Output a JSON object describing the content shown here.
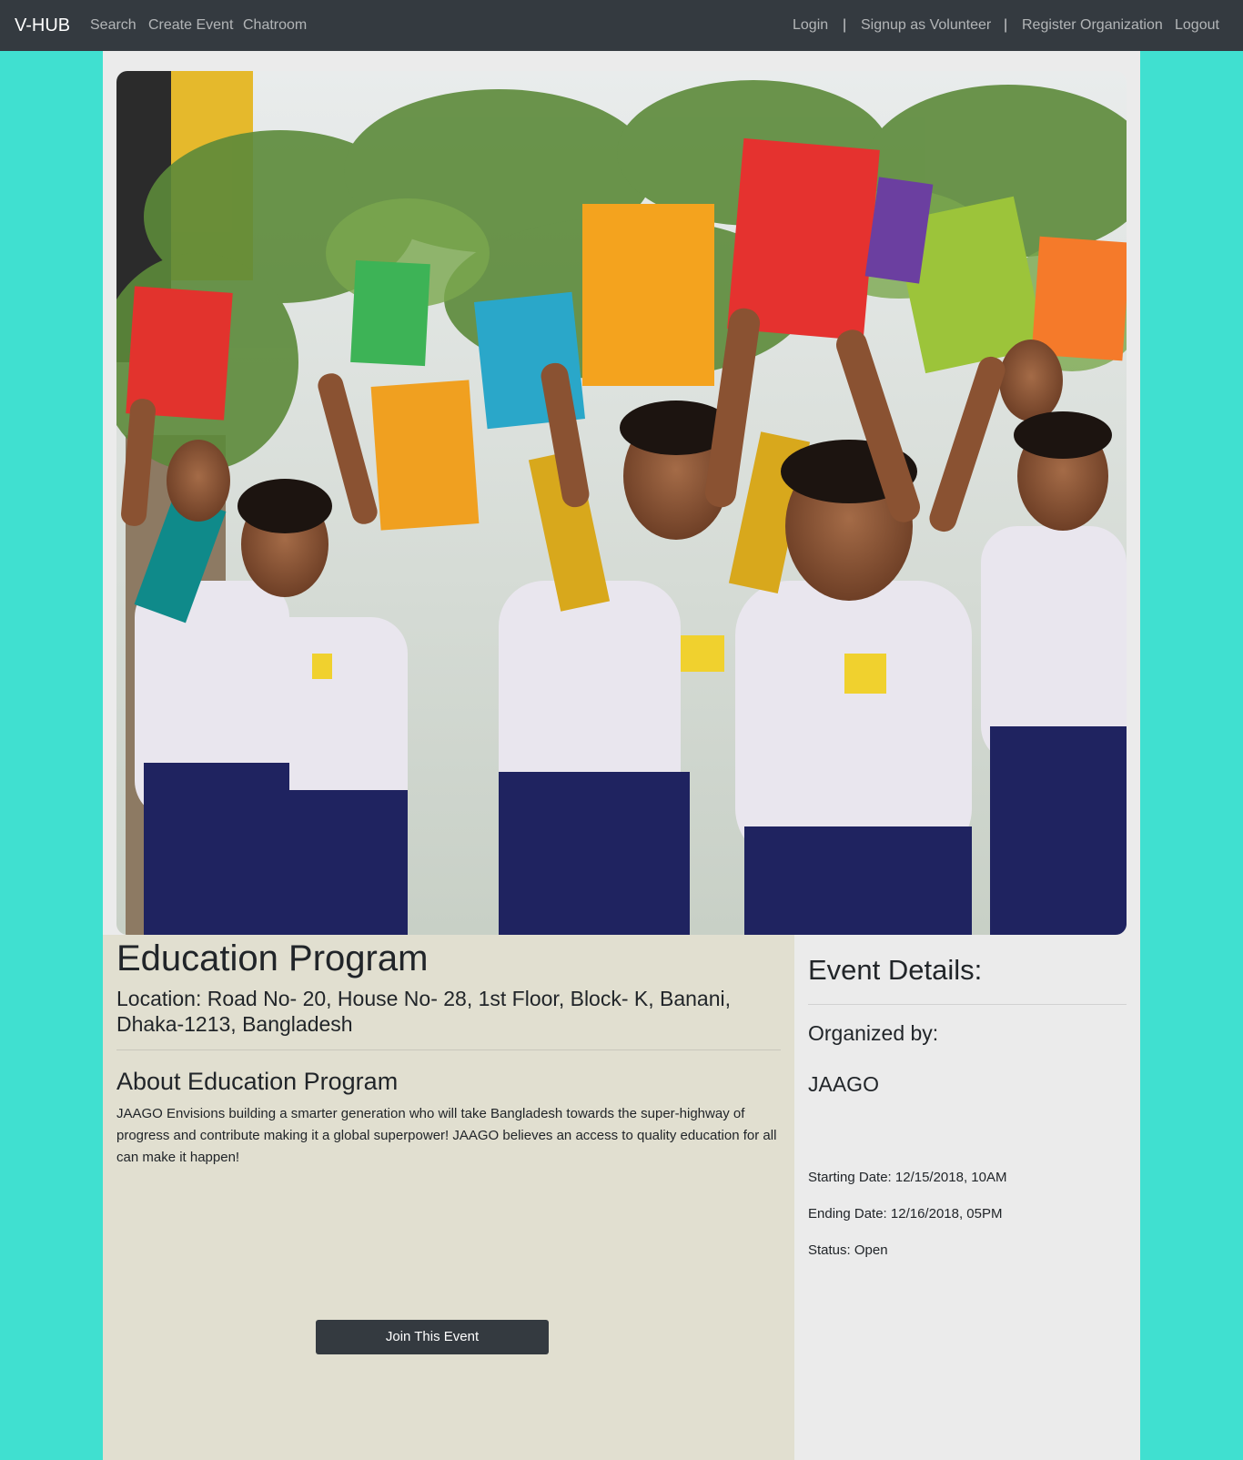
{
  "navbar": {
    "brand": "V-HUB",
    "left_links": [
      "Search",
      "Create Event",
      "Chatroom"
    ],
    "right_links": [
      "Login",
      "Signup as Volunteer",
      "Register Organization",
      "Logout"
    ],
    "separator": "|"
  },
  "hero": {
    "subject": "children in school uniforms holding up textbooks"
  },
  "event": {
    "title": "Education Program",
    "location": "Location: Road No- 20, House No- 28, 1st Floor, Block- K, Banani, Dhaka-1213, Bangladesh",
    "about_heading": "About Education Program",
    "about_text": "JAAGO Envisions building a smarter generation who will take Bangladesh towards the super-highway of progress and contribute making it a global superpower! JAAGO believes an access to quality education for all can make it happen!",
    "join_label": "Join This Event"
  },
  "details": {
    "heading": "Event Details:",
    "organized_label": "Organized by:",
    "organizer": "JAAGO",
    "starting": "Starting Date: 12/15/2018, 10AM",
    "ending": "Ending Date: 12/16/2018, 05PM",
    "status": "Status: Open"
  },
  "colors": {
    "page_background": "#40e0d0",
    "navbar": "#343a40",
    "container": "#ebebeb",
    "left_panel": "#e1dfd0",
    "button": "#343a40"
  }
}
